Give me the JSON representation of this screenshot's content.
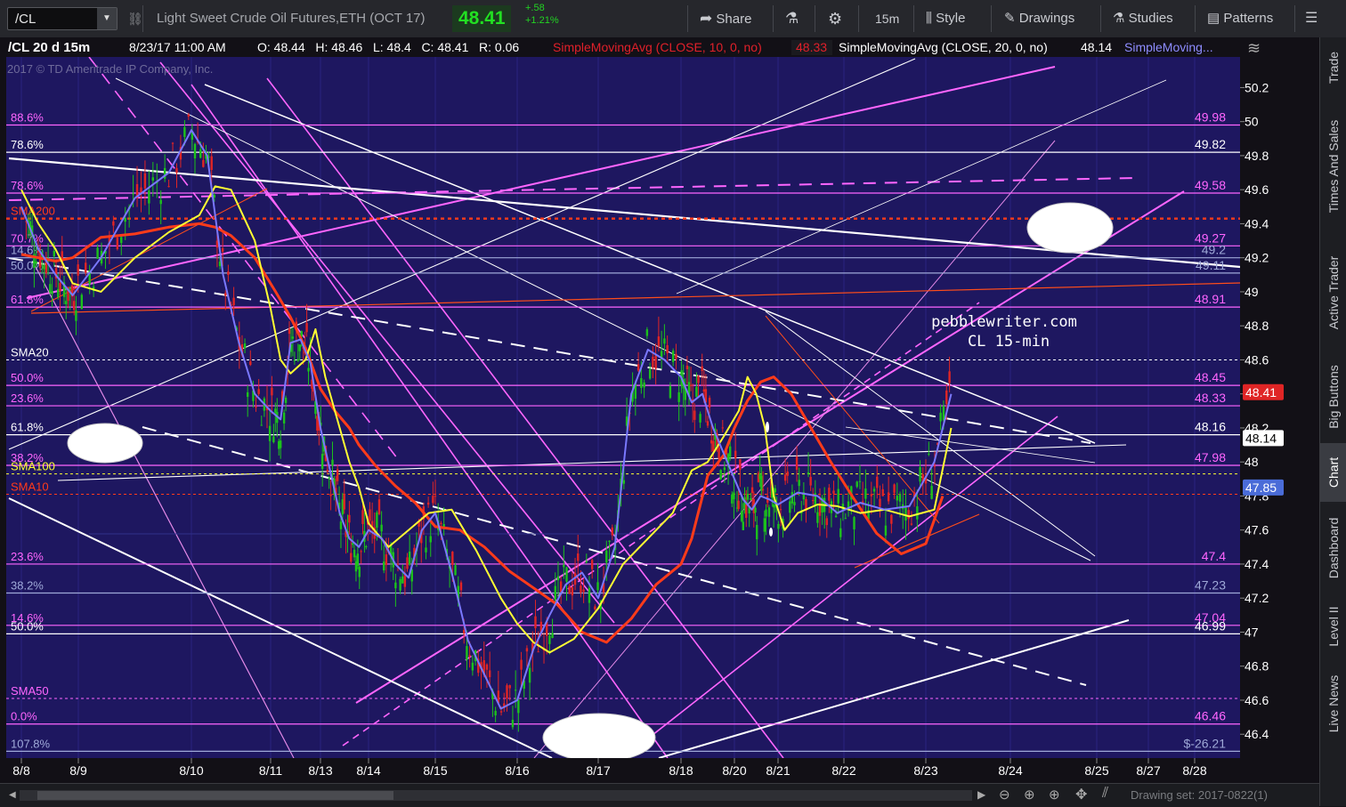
{
  "toolbar": {
    "symbol": "/CL",
    "instrument": "Light Sweet Crude Oil Futures,ETH (OCT 17)",
    "last": "48.41",
    "change": "+.58",
    "change_pct": "+1.21%",
    "share": "Share",
    "interval": "15m",
    "style": "Style",
    "drawings": "Drawings",
    "studies": "Studies",
    "patterns": "Patterns"
  },
  "right_tabs": [
    "Trade",
    "Times And Sales",
    "Active Trader",
    "Big Buttons",
    "Chart",
    "Dashboard",
    "Level II",
    "Live News"
  ],
  "header": {
    "title": "/CL 20 d 15m",
    "date": "8/23/17 11:00 AM",
    "ohlc": "O: 48.44   H: 48.46   L: 48.4   C: 48.41   R: 0.06",
    "sma10": "SimpleMovingAvg (CLOSE, 10, 0, no)",
    "sma10_val": "48.33",
    "sma20": "SimpleMovingAvg (CLOSE, 20, 0, no)",
    "sma20_val": "48.14",
    "sma3": "SimpleMoving..."
  },
  "watermark": "2017 © TD Ameritrade IP Company, Inc.",
  "annotation": {
    "line1": "pebblewriter.com",
    "line2": "CL 15-min"
  },
  "footer": {
    "drawing_set": "Drawing set: 2017-0822(1)"
  },
  "colors": {
    "background": "#1e1760",
    "fib_magenta": "#ff66ff",
    "white": "#ffffff",
    "sma10": "#ff3b1a",
    "sma20": "#ffff33",
    "sma50": "#ff33ff",
    "sma_blue": "#7a78ff",
    "price_up": "#1cc21c",
    "price_down": "#e02525"
  },
  "chart_data": {
    "type": "line",
    "instrument": "/CL 15m",
    "x_ticks": [
      "8/8",
      "8/9",
      "8/10",
      "8/11",
      "8/13",
      "8/14",
      "8/15",
      "8/16",
      "8/17",
      "8/18",
      "8/20",
      "8/21",
      "8/22",
      "8/23",
      "8/24",
      "8/25",
      "8/27",
      "8/28"
    ],
    "y_ticks": [
      46.4,
      46.6,
      46.8,
      47,
      47.2,
      47.4,
      47.6,
      47.8,
      48,
      48.2,
      48.4,
      48.6,
      48.8,
      49,
      49.2,
      49.4,
      49.6,
      49.8,
      50,
      50.2
    ],
    "ylim": [
      46.26,
      50.38
    ],
    "xlim": [
      0,
      17.85
    ],
    "series": [
      {
        "name": "SMA10",
        "color": "#ff3b1a",
        "x": [
          0,
          0.3,
          0.6,
          0.9,
          1.2,
          1.5,
          1.8,
          2.1,
          2.3,
          2.5,
          2.8,
          3.1,
          3.4,
          3.7,
          4.0,
          4.3,
          4.6,
          4.8,
          5.1,
          5.4,
          5.7,
          6.0,
          6.3,
          6.6,
          6.9,
          7.2,
          7.5,
          7.8,
          8.1,
          8.4,
          8.7,
          9.0,
          9.2,
          9.5,
          9.8,
          10.0,
          10.3,
          10.6,
          10.9,
          11.2,
          11.5,
          11.8,
          12.1,
          12.4,
          12.7,
          13.0,
          13.2
        ],
        "y": [
          49.22,
          49.2,
          49.18,
          49.2,
          49.32,
          49.34,
          49.38,
          49.4,
          49.38,
          49.33,
          49.2,
          49.0,
          48.85,
          48.67,
          48.43,
          48.3,
          48.2,
          48.1,
          47.98,
          47.86,
          47.76,
          47.62,
          47.6,
          47.5,
          47.36,
          47.26,
          47.16,
          47.0,
          46.94,
          47.08,
          47.28,
          47.4,
          47.55,
          47.92,
          48.04,
          48.2,
          48.36,
          48.47,
          48.5,
          48.4,
          48.2,
          48.0,
          47.8,
          47.58,
          47.46,
          47.52,
          47.8
        ]
      },
      {
        "name": "SMA20",
        "color": "#ffff33",
        "x": [
          0,
          0.3,
          0.6,
          0.9,
          1.2,
          1.5,
          1.8,
          2.1,
          2.3,
          2.5,
          2.8,
          3.0,
          3.2,
          3.4,
          3.7,
          3.9,
          4.1,
          4.4,
          4.6,
          4.8,
          5.0,
          5.3,
          5.6,
          5.9,
          6.2,
          6.5,
          6.8,
          7.0,
          7.2,
          7.4,
          7.7,
          8.0,
          8.3,
          8.6,
          8.9,
          9.2,
          9.5,
          9.8,
          10.1,
          10.3,
          10.5,
          10.7,
          10.9,
          11.1,
          11.3,
          11.6,
          11.9,
          12.2,
          12.5,
          12.8,
          13.1,
          13.3
        ],
        "y": [
          49.6,
          49.4,
          49.25,
          49.05,
          49.0,
          49.2,
          49.35,
          49.45,
          49.62,
          49.6,
          49.3,
          48.9,
          48.6,
          48.52,
          48.6,
          48.78,
          48.5,
          48.2,
          48.0,
          47.85,
          47.64,
          47.5,
          47.6,
          47.7,
          47.72,
          47.48,
          47.2,
          47.05,
          46.94,
          46.88,
          46.96,
          47.14,
          47.4,
          47.55,
          47.7,
          47.95,
          48.0,
          48.15,
          48.3,
          48.5,
          48.4,
          48.2,
          47.8,
          47.6,
          47.7,
          47.75,
          47.74,
          47.7,
          47.72,
          47.68,
          47.72,
          48.2
        ]
      },
      {
        "name": "SMA (blue)",
        "color": "#7a78ff",
        "x": [
          0,
          0.3,
          0.6,
          0.9,
          1.2,
          1.5,
          1.8,
          2.0,
          2.2,
          2.4,
          2.6,
          2.8,
          3.0,
          3.2,
          3.4,
          3.6,
          3.8,
          4.0,
          4.2,
          4.4,
          4.6,
          4.8,
          5.0,
          5.2,
          5.4,
          5.6,
          5.8,
          6.0,
          6.2,
          6.4,
          6.6,
          6.8,
          7.0,
          7.2,
          7.4,
          7.6,
          7.8,
          8.0,
          8.2,
          8.4,
          8.6,
          8.8,
          9.0,
          9.2,
          9.4,
          9.6,
          9.8,
          10.0,
          10.2,
          10.4,
          10.6,
          10.8,
          11.0,
          11.3,
          11.6,
          11.9,
          12.2,
          12.5,
          12.8,
          13.1,
          13.3
        ],
        "y": [
          49.5,
          49.25,
          49.1,
          48.98,
          49.2,
          49.55,
          49.7,
          49.95,
          49.8,
          49.1,
          48.7,
          48.4,
          48.3,
          48.25,
          48.7,
          48.72,
          48.58,
          48.2,
          47.95,
          47.7,
          47.55,
          47.5,
          47.6,
          47.55,
          47.4,
          47.32,
          47.6,
          47.7,
          47.35,
          46.95,
          46.75,
          46.55,
          46.6,
          46.9,
          47.1,
          47.28,
          47.35,
          47.2,
          47.5,
          48.4,
          48.66,
          48.6,
          48.5,
          48.35,
          48.4,
          48.2,
          48.05,
          47.9,
          47.78,
          47.72,
          47.8,
          47.78,
          47.75,
          47.82,
          47.8,
          47.7,
          47.76,
          47.72,
          47.74,
          48.0,
          48.4
        ]
      }
    ],
    "sma_markers": [
      {
        "label": "SMA200",
        "value": 49.43
      },
      {
        "label": "SMA20",
        "value": 48.6
      },
      {
        "label": "SMA100",
        "value": 47.93
      },
      {
        "label": "SMA10",
        "value": 47.81
      },
      {
        "label": "SMA50",
        "value": 46.61
      }
    ],
    "fib_levels": [
      {
        "label": "88.6%",
        "value": 49.98,
        "value_label": "49.98"
      },
      {
        "label": "78.6%",
        "value": 49.82,
        "value_label": "49.82"
      },
      {
        "label": "78.6%",
        "value": 49.58,
        "value_label": "49.58"
      },
      {
        "label": "70.7%",
        "value": 49.27,
        "value_label": "49.27"
      },
      {
        "label": "14.6%",
        "value": 49.2,
        "value_label": "49.2"
      },
      {
        "label": "50.0%",
        "value": 49.11,
        "value_label": "49.11"
      },
      {
        "label": "61.8%",
        "value": 48.91,
        "value_label": "48.91"
      },
      {
        "label": "50.0%",
        "value": 48.45,
        "value_label": "48.45"
      },
      {
        "label": "23.6%",
        "value": 48.33,
        "value_label": "48.33"
      },
      {
        "label": "61.8%",
        "value": 48.16,
        "value_label": "48.16"
      },
      {
        "label": "38.2%",
        "value": 47.98,
        "value_label": "47.98"
      },
      {
        "label": "23.6%",
        "value": 47.4,
        "value_label": "47.4"
      },
      {
        "label": "38.2%",
        "value": 47.23,
        "value_label": "47.23"
      },
      {
        "label": "14.6%",
        "value": 47.04,
        "value_label": "47.04"
      },
      {
        "label": "50.0%",
        "value": 46.99,
        "value_label": "46.99"
      },
      {
        "label": "0.0%",
        "value": 46.46,
        "value_label": "46.46"
      },
      {
        "label": "107.8%",
        "value": 46.3,
        "value_label": "$-26.21"
      }
    ],
    "price_tags": [
      {
        "value": 48.41,
        "label": "48.41",
        "color": "#e02525"
      },
      {
        "value": 48.14,
        "label": "48.14",
        "color": "#ffffff"
      },
      {
        "value": 47.85,
        "label": "47.85",
        "color": "#4a6cd8"
      }
    ]
  }
}
